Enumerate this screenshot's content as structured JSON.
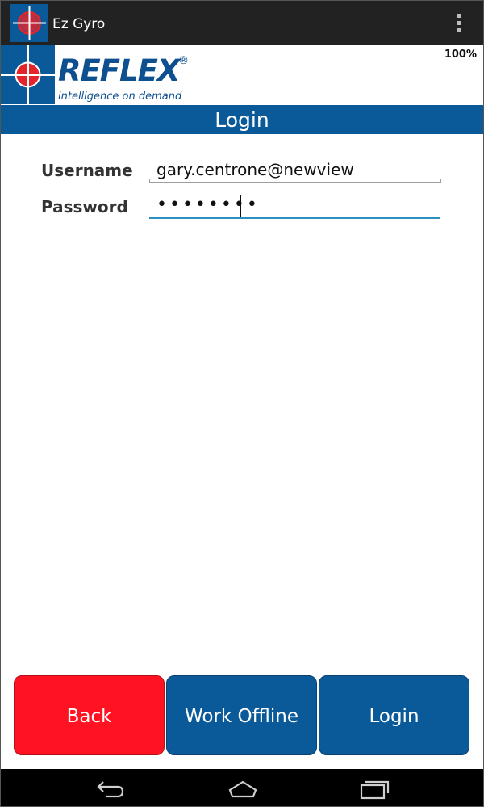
{
  "app": {
    "title": "Ez Gyro"
  },
  "status": {
    "battery": "100%"
  },
  "logo": {
    "brand": "REFLEX",
    "registered": "®",
    "tagline": "intelligence on demand"
  },
  "header": {
    "title": "Login"
  },
  "form": {
    "username_label": "Username",
    "username_value": "gary.centrone@newview",
    "password_label": "Password",
    "password_value": "••••••••"
  },
  "buttons": {
    "back": "Back",
    "work_offline": "Work Offline",
    "login": "Login"
  },
  "colors": {
    "brand_blue": "#0a5a9a",
    "danger_red": "#ff1221",
    "action_bar": "#222222",
    "focus_line": "#2b8fbf"
  },
  "icons": {
    "app": "reflex-crosshair-icon",
    "overflow": "overflow-menu-icon",
    "nav_back": "back-icon",
    "nav_home": "home-icon",
    "nav_recents": "recents-icon"
  }
}
